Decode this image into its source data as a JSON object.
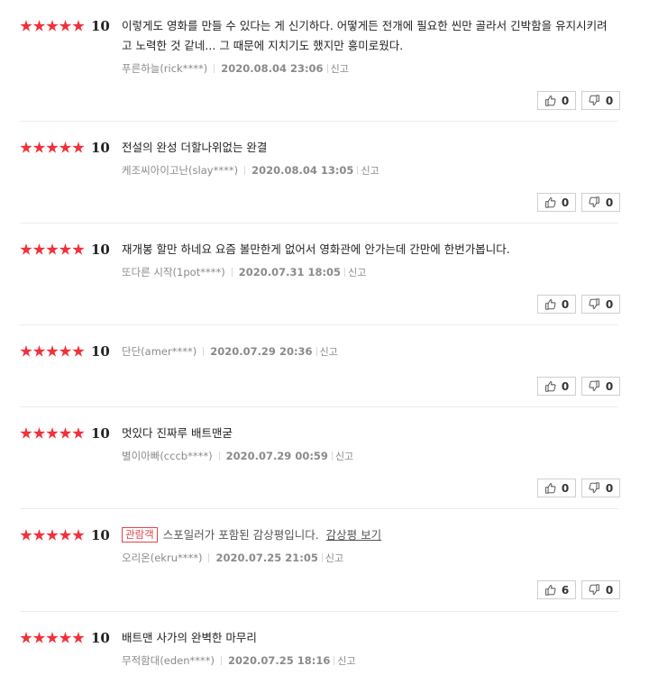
{
  "reviews": [
    {
      "score": "10",
      "text": "이렇게도 영화를 만들 수 있다는 게 신기하다. 어떻게든 전개에 필요한 씬만 골라서 긴박함을 유지시키려고 노력한 것 같네... 그 때문에 지치기도 했지만 흥미로웠다.",
      "author": "푸른하늘(rick****)",
      "date": "2020.08.04 23:06",
      "report": "신고",
      "likes": "0",
      "dislikes": "0"
    },
    {
      "score": "10",
      "text": "전설의 완성 더할나위없는 완결",
      "author": "케조씨아이고난(slay****)",
      "date": "2020.08.04 13:05",
      "report": "신고",
      "likes": "0",
      "dislikes": "0"
    },
    {
      "score": "10",
      "text": "재개봉 할만 하네요 요즘 볼만한게 없어서 영화관에 안가는데 간만에 한번가봅니다.",
      "author": "또다른 시작(1pot****)",
      "date": "2020.07.31 18:05",
      "report": "신고",
      "likes": "0",
      "dislikes": "0"
    },
    {
      "score": "10",
      "text": "",
      "author": "단단(amer****)",
      "date": "2020.07.29 20:36",
      "report": "신고",
      "likes": "0",
      "dislikes": "0"
    },
    {
      "score": "10",
      "text": "멋있다 진짜루 배트맨굳",
      "author": "별이아빠(cccb****)",
      "date": "2020.07.29 00:59",
      "report": "신고",
      "likes": "0",
      "dislikes": "0"
    },
    {
      "score": "10",
      "badge": "관람객",
      "spoiler_text": "스포일러가 포함된 감상평입니다.",
      "spoiler_link": "감상평 보기",
      "author": "오리온(ekru****)",
      "date": "2020.07.25 21:05",
      "report": "신고",
      "likes": "6",
      "dislikes": "0"
    },
    {
      "score": "10",
      "text": "배트맨 사가의 완벽한 마무리",
      "author": "무적함대(eden****)",
      "date": "2020.07.25 18:16",
      "report": "신고"
    }
  ],
  "icons": {
    "like": "thumbs-up-icon",
    "dislike": "thumbs-down-icon",
    "star": "star-icon"
  },
  "colors": {
    "star": "#f1303a",
    "badge": "#e0454b"
  }
}
